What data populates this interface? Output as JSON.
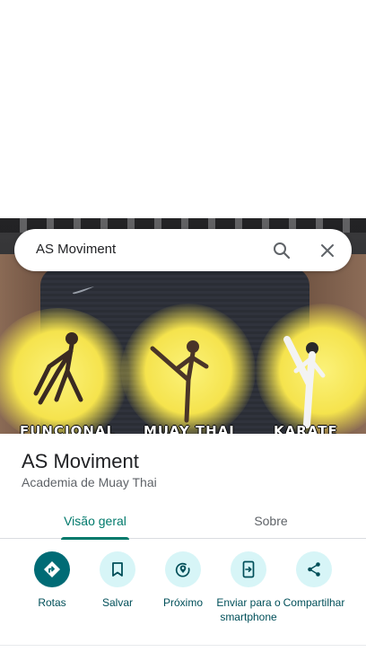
{
  "search": {
    "query": "AS Moviment",
    "search_icon": "search-icon",
    "clear_icon": "close-icon"
  },
  "hero": {
    "captions": [
      "FUNCIONAL",
      "MUAY THAI",
      "KARATE"
    ]
  },
  "place": {
    "name": "AS Moviment",
    "category": "Academia de Muay Thai"
  },
  "tabs": [
    {
      "label": "Visão geral",
      "active": true
    },
    {
      "label": "Sobre",
      "active": false
    }
  ],
  "actions": [
    {
      "label": "Rotas",
      "icon": "directions-icon",
      "primary": true
    },
    {
      "label": "Salvar",
      "icon": "bookmark-icon",
      "primary": false
    },
    {
      "label": "Próximo",
      "icon": "nearby-icon",
      "primary": false
    },
    {
      "label": "Enviar para o smartphone",
      "icon": "send-to-phone-icon",
      "primary": false
    },
    {
      "label": "Compartilhar",
      "icon": "share-icon",
      "primary": false
    }
  ],
  "colors": {
    "accent": "#00796b",
    "primary_action": "#006b75",
    "action_bg": "#d7f5f7",
    "action_text": "#004f59"
  }
}
